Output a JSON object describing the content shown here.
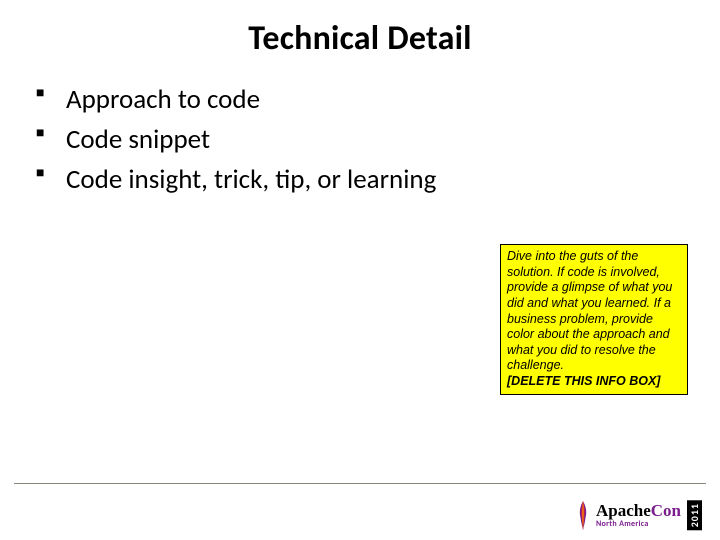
{
  "slide": {
    "title": "Technical Detail",
    "bullets": [
      "Approach to code",
      "Code snippet",
      "Code insight, trick, tip, or learning"
    ]
  },
  "info_box": {
    "body": "Dive into the guts of the solution. If code is involved, provide a glimpse of what you did and what you learned. If a business problem, provide color about the approach and what you did to resolve the challenge.",
    "delete_note": "[DELETE THIS INFO BOX]"
  },
  "footer": {
    "brand_prefix": "Apache",
    "brand_suffix": "Con",
    "subtitle": "North America",
    "year": "2011"
  }
}
